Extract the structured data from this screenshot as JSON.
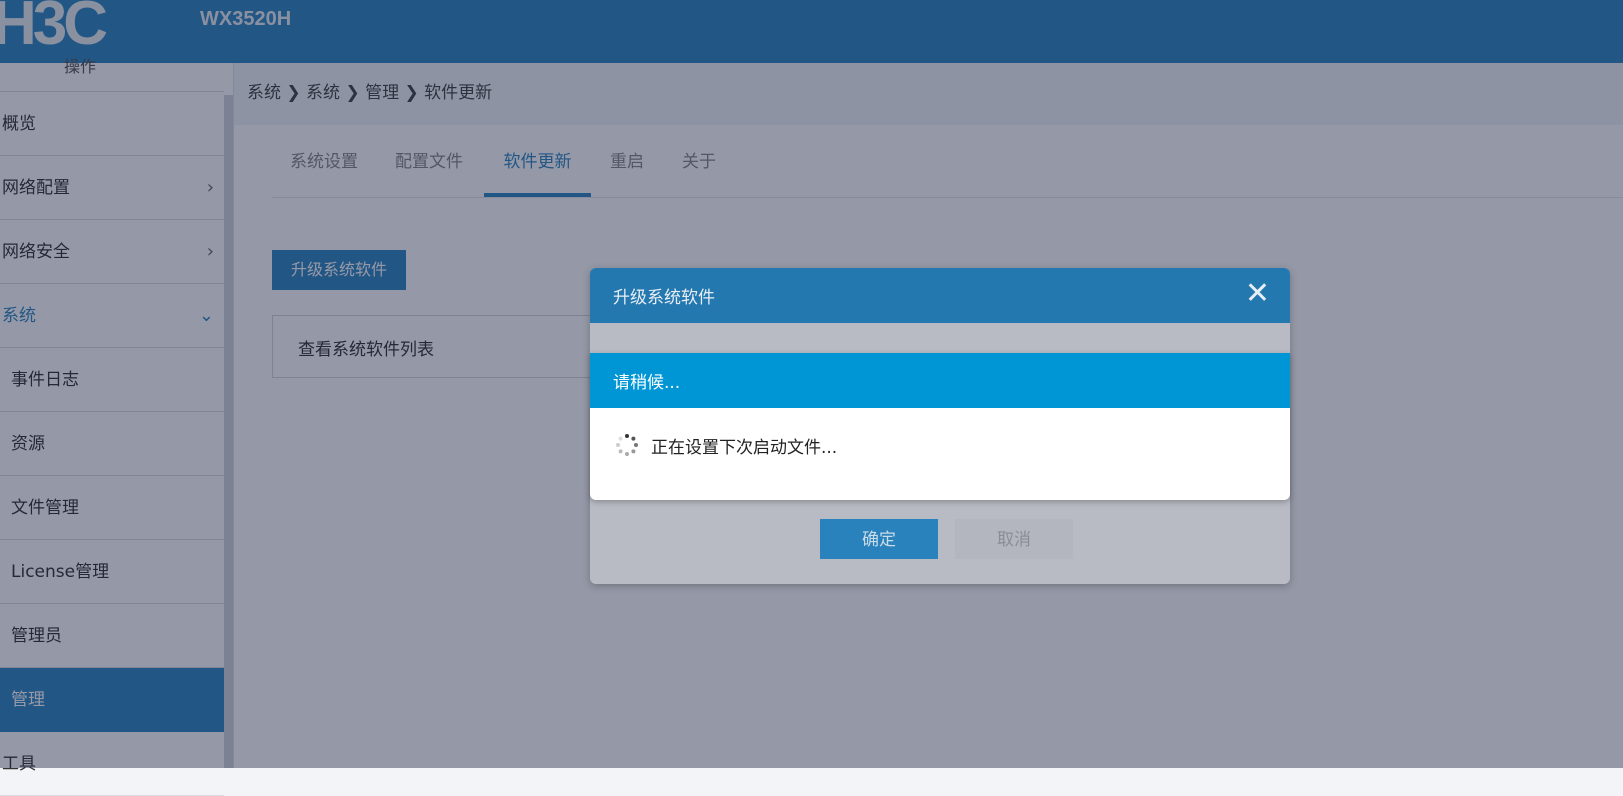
{
  "header": {
    "logo": "H3C",
    "model": "WX3520H"
  },
  "sidebar": {
    "partial_top": "操作",
    "items": [
      {
        "label": "概览"
      },
      {
        "label": "网络配置",
        "chev": "›"
      },
      {
        "label": "网络安全",
        "chev": "›"
      },
      {
        "label": "系统",
        "chev": "⌄"
      },
      {
        "label": "事件日志"
      },
      {
        "label": "资源"
      },
      {
        "label": "文件管理"
      },
      {
        "label": "License管理"
      },
      {
        "label": "管理员"
      },
      {
        "label": "管理"
      },
      {
        "label": "工具"
      }
    ]
  },
  "breadcrumb": {
    "text": "系统 ❯ 系统 ❯ 管理 ❯ 软件更新"
  },
  "tabs": [
    {
      "label": "系统设置"
    },
    {
      "label": "配置文件"
    },
    {
      "label": "软件更新"
    },
    {
      "label": "重启"
    },
    {
      "label": "关于"
    }
  ],
  "main": {
    "upgrade_button": "升级系统软件",
    "view_list": "查看系统软件列表"
  },
  "modal": {
    "title": "升级系统软件",
    "close": "✕",
    "ok": "确定",
    "cancel": "取消"
  },
  "wait": {
    "title": "请稍候...",
    "message": "正在设置下次启动文件..."
  },
  "colors": {
    "brand": "#2f86c2",
    "wait_header": "#0096d6"
  }
}
